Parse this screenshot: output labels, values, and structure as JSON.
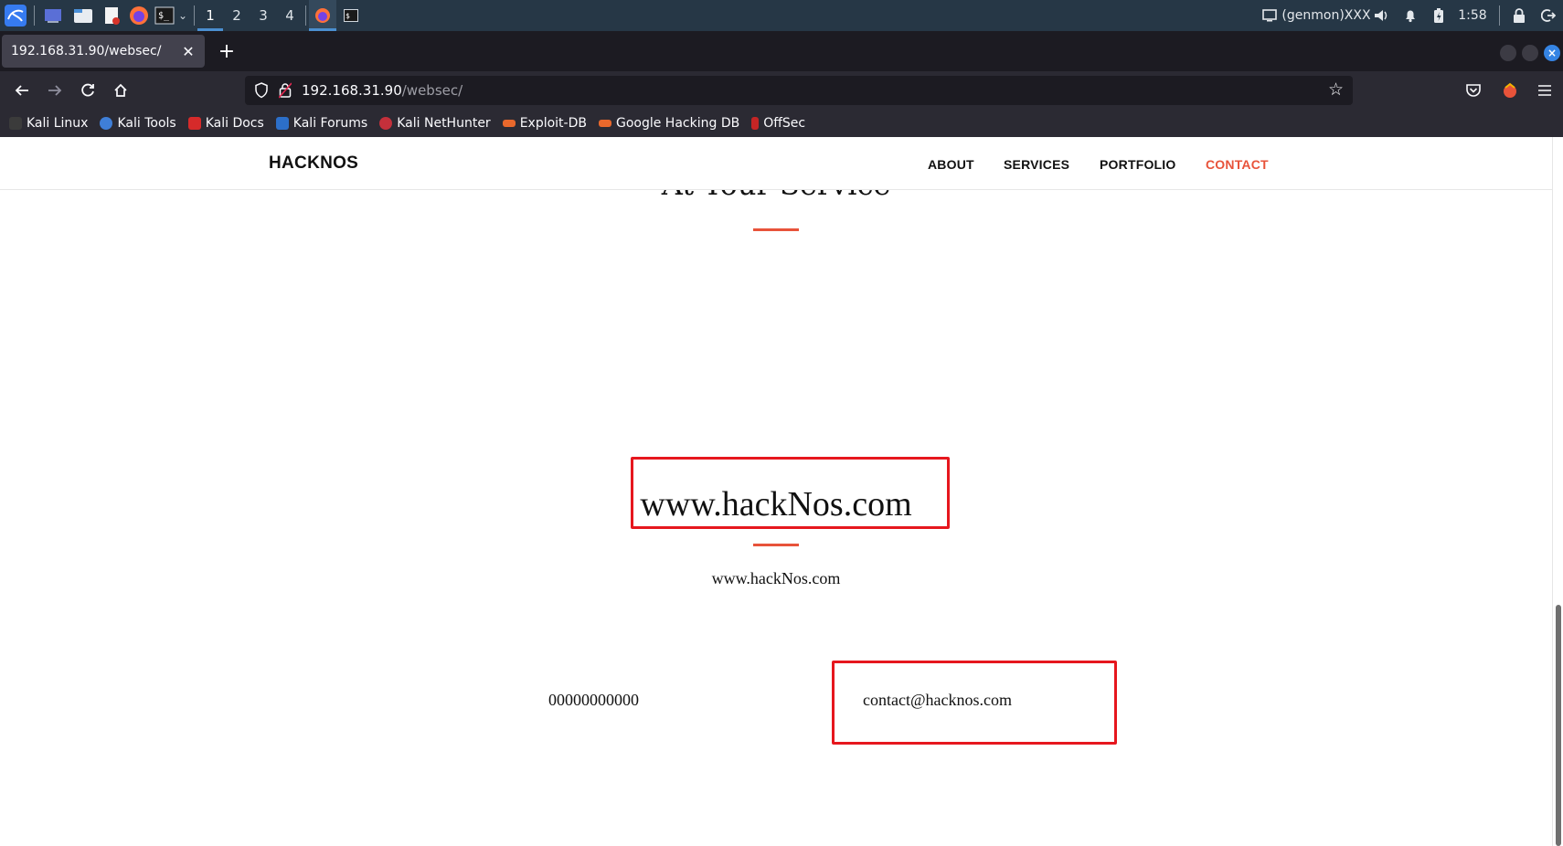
{
  "taskbar": {
    "workspaces": [
      "1",
      "2",
      "3",
      "4"
    ],
    "genmon": "(genmon)XXX",
    "clock": "1:58"
  },
  "browser": {
    "tab_title": "192.168.31.90/websec/",
    "url_host": "192.168.31.90",
    "url_path": "/websec/",
    "bookmarks": [
      {
        "label": "Kali Linux",
        "color": "#3b3b3b"
      },
      {
        "label": "Kali Tools",
        "color": "#3f7fd8"
      },
      {
        "label": "Kali Docs",
        "color": "#d62a2a"
      },
      {
        "label": "Kali Forums",
        "color": "#2c6fc9"
      },
      {
        "label": "Kali NetHunter",
        "color": "#c4303b"
      },
      {
        "label": "Exploit-DB",
        "color": "#e9682c"
      },
      {
        "label": "Google Hacking DB",
        "color": "#e9682c"
      },
      {
        "label": "OffSec",
        "color": "#c42525"
      }
    ]
  },
  "site": {
    "brand": "HACKNOS",
    "menu": {
      "about": "ABOUT",
      "services": "SERVICES",
      "portfolio": "PORTFOLIO",
      "contact": "CONTACT"
    },
    "heading": "At Your Service",
    "title": "www.hackNos.com",
    "subtitle": "www.hackNos.com",
    "phone": "00000000000",
    "email": "contact@hacknos.com",
    "accent_color": "#e8533a",
    "highlight_color": "#e6171e"
  }
}
